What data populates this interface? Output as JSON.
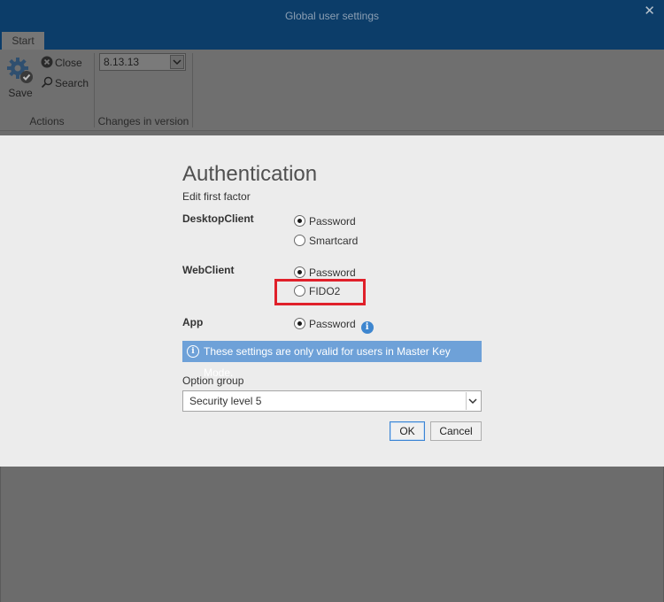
{
  "window": {
    "title": "Global user settings",
    "close_glyph": "✕"
  },
  "tabs": [
    {
      "label": "Start"
    }
  ],
  "ribbon": {
    "actions": {
      "save_label": "Save",
      "close_label": "Close",
      "search_label": "Search",
      "group_label": "Actions"
    },
    "version": {
      "selected": "8.13.13",
      "group_label": "Changes in version"
    }
  },
  "dialog": {
    "title": "Authentication",
    "subtitle": "Edit first factor",
    "sections": [
      {
        "label": "DesktopClient",
        "options": [
          {
            "label": "Password",
            "selected": true
          },
          {
            "label": "Smartcard",
            "selected": false
          }
        ]
      },
      {
        "label": "WebClient",
        "options": [
          {
            "label": "Password",
            "selected": true
          },
          {
            "label": "FIDO2",
            "selected": false
          }
        ]
      },
      {
        "label": "App",
        "options": [
          {
            "label": "Password",
            "selected": true
          }
        ]
      }
    ],
    "notice": "These settings are only valid for users in Master Key Mode.",
    "option_group": {
      "label": "Option group",
      "selected": "Security level 5"
    },
    "ok_label": "OK",
    "cancel_label": "Cancel"
  },
  "icons": {
    "info": "info-icon",
    "save": "gear-check-icon",
    "close": "close-circle-icon",
    "search": "search-icon"
  },
  "colors": {
    "highlight": "#e0202a",
    "notice_bg": "#6ea1d8",
    "title_bar": "#0c3d69"
  }
}
